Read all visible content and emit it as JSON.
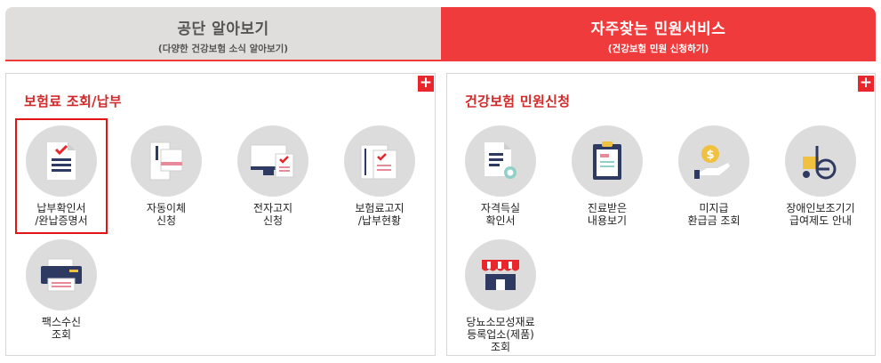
{
  "tabs": {
    "inactive": {
      "title": "공단 알아보기",
      "subtitle": "(다양한 건강보험 소식 알아보기)"
    },
    "active": {
      "title": "자주찾는 민원서비스",
      "subtitle": "(건강보험 민원 신청하기)"
    }
  },
  "left_panel": {
    "title": "보험료 조회/납부",
    "plus": "+",
    "items": [
      {
        "label": "납부확인서\n/완납증명서",
        "icon": "document-check-icon"
      },
      {
        "label": "자동이체\n신청",
        "icon": "auto-transfer-icon"
      },
      {
        "label": "전자고지\n신청",
        "icon": "monitor-document-icon"
      },
      {
        "label": "보험료고지\n/납부현황",
        "icon": "envelope-document-icon"
      },
      {
        "label": "팩스수신\n조회",
        "icon": "fax-icon"
      }
    ]
  },
  "right_panel": {
    "title": "건강보험 민원신청",
    "plus": "+",
    "items": [
      {
        "label": "자격득실\n확인서",
        "icon": "certificate-icon"
      },
      {
        "label": "진료받은\n내용보기",
        "icon": "clipboard-icon"
      },
      {
        "label": "미지급\n환급금 조회",
        "icon": "refund-coin-icon"
      },
      {
        "label": "장애인보조기기\n급여제도 안내",
        "icon": "wheelchair-icon"
      },
      {
        "label": "당뇨소모성재료\n등록업소(제품)\n조회",
        "icon": "store-icon"
      }
    ]
  },
  "colors": {
    "accent": "#ef3b3b",
    "title_red": "#d22a2a",
    "navy": "#2f3a63",
    "circle": "#dcdcdc"
  }
}
